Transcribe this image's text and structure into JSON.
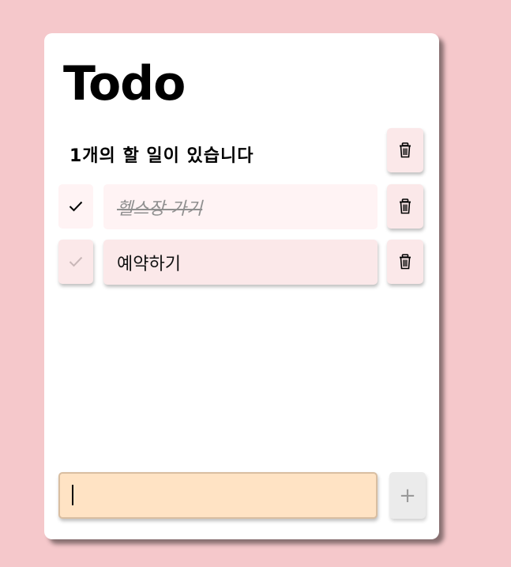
{
  "header": {
    "title": "Todo"
  },
  "summary": {
    "text": "1개의 할 일이 있습니다"
  },
  "todos": [
    {
      "text": "헬스장 가기",
      "done": true
    },
    {
      "text": "예약하기",
      "done": false
    }
  ],
  "new_todo": {
    "value": "",
    "placeholder": ""
  },
  "icons": {
    "delete": "trash-icon",
    "check": "check-icon",
    "add": "plus-icon"
  },
  "add_label": "+",
  "colors": {
    "background": "#f5c8cb",
    "card": "#ffffff",
    "item": "#fbe8e9",
    "item_done": "#fff3f4",
    "input": "#ffe3c4",
    "add_button": "#ebebeb"
  }
}
